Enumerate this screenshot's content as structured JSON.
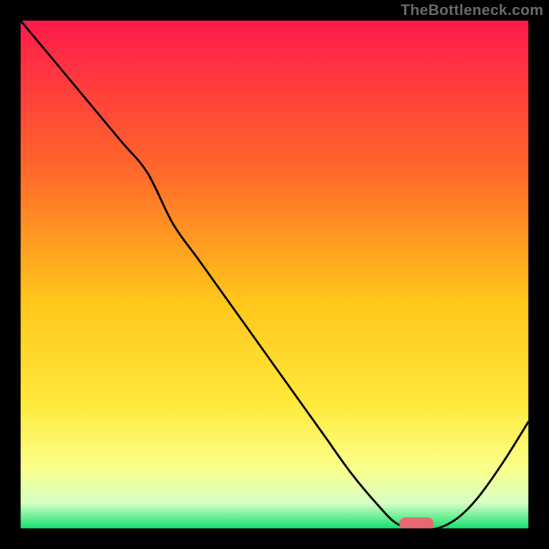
{
  "watermark": "TheBottleneck.com",
  "colors": {
    "gradient_top": "#ff1a4b",
    "gradient_mid_upper": "#ff6a2a",
    "gradient_mid": "#ffd21a",
    "gradient_low": "#fbff8a",
    "gradient_near_bottom": "#ecffd0",
    "gradient_bottom": "#17e070",
    "line": "#000000",
    "marker": "#e46a6f",
    "frame": "#000000",
    "plot_bg": "#ffffff"
  },
  "chart_data": {
    "type": "line",
    "title": "",
    "xlabel": "",
    "ylabel": "",
    "xlim": [
      0,
      100
    ],
    "ylim": [
      0,
      100
    ],
    "grid": false,
    "legend": false,
    "series": [
      {
        "name": "bottleneck-curve",
        "x": [
          0,
          5,
          10,
          15,
          20,
          25,
          30,
          35,
          40,
          45,
          50,
          55,
          60,
          65,
          70,
          74,
          78,
          82,
          86,
          90,
          95,
          100
        ],
        "values": [
          100,
          94,
          88,
          82,
          76,
          70,
          60,
          53,
          46,
          39,
          32,
          25,
          18,
          11,
          5,
          1,
          0,
          0,
          2,
          6,
          13,
          21
        ]
      }
    ],
    "marker": {
      "x": 78,
      "y": 1
    },
    "gradient_stops": [
      {
        "offset": 0.0,
        "color": "#ff1a4b"
      },
      {
        "offset": 0.3,
        "color": "#ff6a2a"
      },
      {
        "offset": 0.55,
        "color": "#ffc61a"
      },
      {
        "offset": 0.75,
        "color": "#ffe93a"
      },
      {
        "offset": 0.88,
        "color": "#fbff8a"
      },
      {
        "offset": 0.95,
        "color": "#d7ffc4"
      },
      {
        "offset": 1.0,
        "color": "#17e070"
      }
    ]
  }
}
